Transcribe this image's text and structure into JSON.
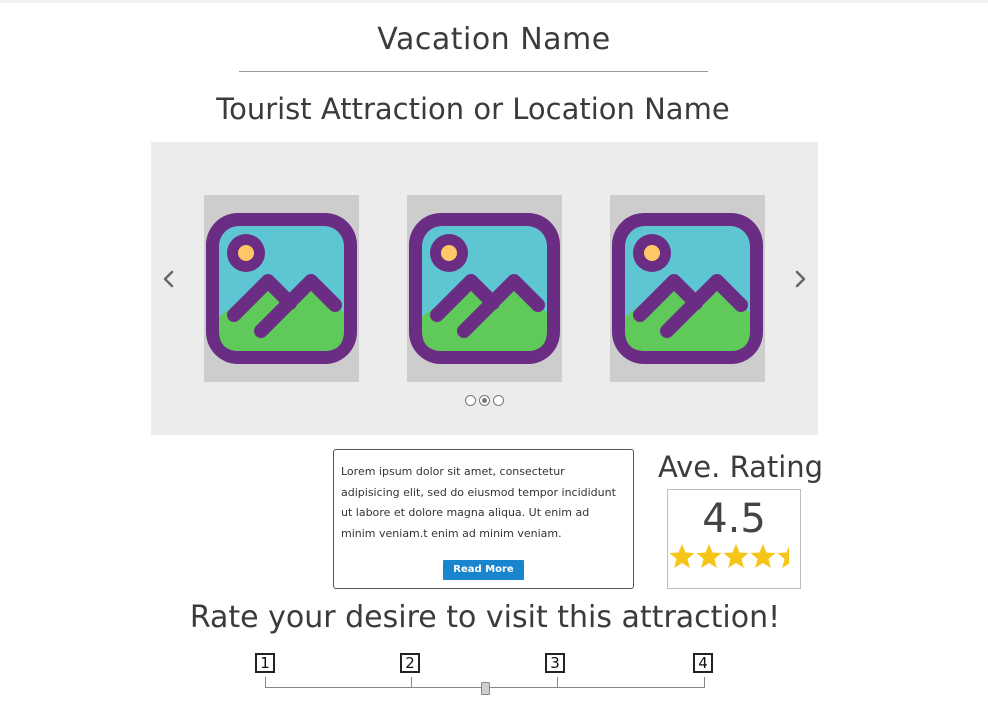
{
  "header": {
    "vacation_name": "Vacation Name",
    "attraction_name": "Tourist Attraction or Location Name"
  },
  "carousel": {
    "prev_icon": "chevron-left-icon",
    "next_icon": "chevron-right-icon",
    "slides": [
      {
        "icon": "image-placeholder-icon"
      },
      {
        "icon": "image-placeholder-icon"
      },
      {
        "icon": "image-placeholder-icon"
      }
    ],
    "pagination": {
      "count": 3,
      "active_index": 1
    }
  },
  "description": {
    "text": "Lorem ipsum dolor sit amet, consectetur adipisicing elit, sed do eiusmod tempor incididunt ut labore et dolore magna aliqua. Ut enim ad minim veniam.t enim ad minim veniam.",
    "read_more_label": "Read More"
  },
  "rating": {
    "label": "Ave. Rating",
    "value": "4.5",
    "stars_filled": 4.5,
    "stars_total": 5,
    "star_color": "#f5c518"
  },
  "desire": {
    "prompt": "Rate your desire to visit this attraction!",
    "scale_labels": [
      "1",
      "2",
      "3",
      "4"
    ],
    "current_value_fraction": 0.5
  },
  "colors": {
    "accent": "#1a85cf",
    "image_frame": "#6b2d84",
    "image_sky": "#5ec6d3",
    "image_grass": "#5fc95a",
    "image_sun": "#ffc766"
  }
}
